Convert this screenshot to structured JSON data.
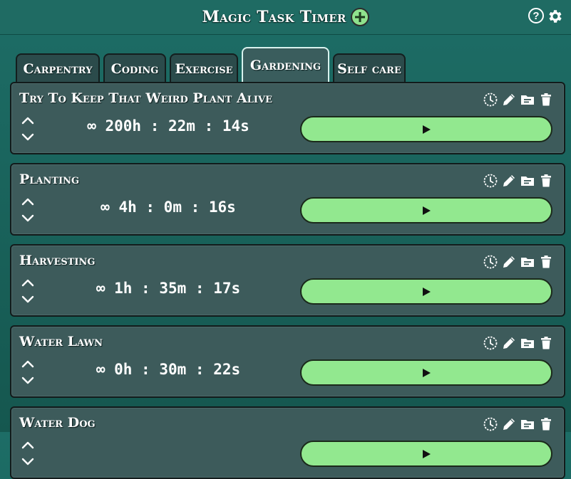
{
  "header": {
    "title": "Magic Task Timer",
    "help_symbol": "?",
    "icons": [
      "add-icon",
      "help-icon",
      "gear-icon"
    ]
  },
  "tabs": [
    {
      "label": "Carpentry",
      "active": false
    },
    {
      "label": "Coding",
      "active": false
    },
    {
      "label": "Exercise",
      "active": false
    },
    {
      "label": "Gardening",
      "active": true
    },
    {
      "label": "Self care",
      "active": false
    }
  ],
  "tasks": [
    {
      "name": "Try To Keep That Weird Plant Alive",
      "time": "∞ 200h : 22m : 14s"
    },
    {
      "name": "Planting",
      "time": "∞ 4h : 0m : 16s"
    },
    {
      "name": "Harvesting",
      "time": "∞ 1h : 35m : 17s"
    },
    {
      "name": "Water Lawn",
      "time": "∞ 0h : 30m : 22s"
    },
    {
      "name": "Water Dog",
      "time": ""
    }
  ],
  "colors": {
    "background": "#1d6d66",
    "card": "#3d5b5b",
    "play_button": "#92e88f",
    "add_button": "#8fe28d"
  }
}
